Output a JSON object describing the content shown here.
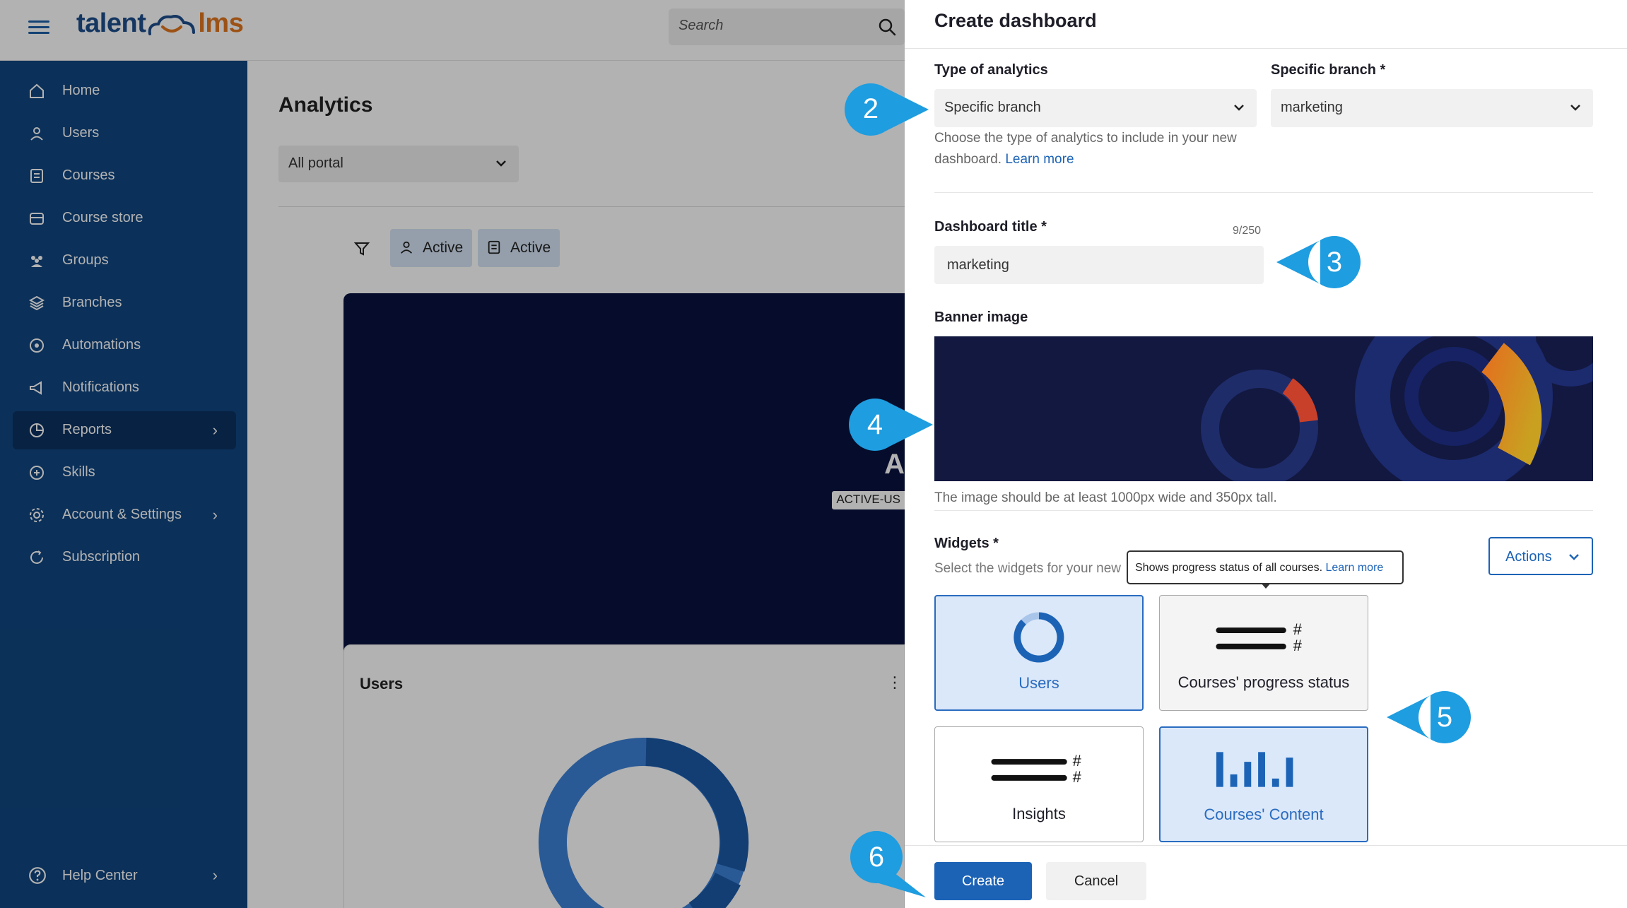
{
  "app": {
    "logo": {
      "part1": "talent",
      "part2": "lms"
    },
    "search": {
      "placeholder": "Search"
    },
    "sidebar": {
      "items": [
        {
          "label": "Home",
          "icon": "home-icon"
        },
        {
          "label": "Users",
          "icon": "user-icon"
        },
        {
          "label": "Courses",
          "icon": "book-icon"
        },
        {
          "label": "Course store",
          "icon": "store-icon"
        },
        {
          "label": "Groups",
          "icon": "group-icon"
        },
        {
          "label": "Branches",
          "icon": "layers-icon"
        },
        {
          "label": "Automations",
          "icon": "automation-icon"
        },
        {
          "label": "Notifications",
          "icon": "megaphone-icon"
        },
        {
          "label": "Reports",
          "icon": "pie-chart-icon",
          "active": true
        },
        {
          "label": "Skills",
          "icon": "skills-icon"
        },
        {
          "label": "Account & Settings",
          "icon": "gear-icon"
        },
        {
          "label": "Subscription",
          "icon": "subscription-icon"
        }
      ],
      "help": {
        "label": "Help Center",
        "icon": "help-circle-icon"
      }
    },
    "main": {
      "title": "Analytics",
      "portal_select": "All portal",
      "chips": [
        {
          "label": "Active",
          "icon": "user-icon"
        },
        {
          "label": "Active",
          "icon": "book-icon"
        }
      ],
      "banner_letter": "A",
      "banner_badge": "ACTIVE-US",
      "users_card_title": "Users",
      "users_card_menu": "⋮"
    }
  },
  "drawer": {
    "title": "Create dashboard",
    "type_of_analytics": {
      "label": "Type of analytics",
      "value": "Specific branch",
      "help": "Choose the type of analytics to include in your new dashboard.",
      "help_link": "Learn more"
    },
    "specific_branch": {
      "label": "Specific branch *",
      "value": "marketing"
    },
    "dashboard_title": {
      "label": "Dashboard title *",
      "value": "marketing",
      "counter": "9/250"
    },
    "banner": {
      "label": "Banner image",
      "note": "The image should be at least 1000px wide and 350px tall."
    },
    "widgets": {
      "label": "Widgets *",
      "subtitle": "Select the widgets for your new",
      "actions_label": "Actions",
      "tooltip": {
        "text": "Shows progress status of all courses.",
        "link": "Learn more"
      },
      "cards": [
        {
          "label": "Users",
          "selected": true,
          "icon": "donut-icon"
        },
        {
          "label": "Courses' progress status",
          "selected": false,
          "icon": "progress-lines-icon"
        },
        {
          "label": "Insights",
          "selected": false,
          "icon": "insights-lines-icon"
        },
        {
          "label": "Courses' Content",
          "selected": true,
          "icon": "bar-chart-icon"
        }
      ]
    },
    "buttons": {
      "create": "Create",
      "cancel": "Cancel"
    }
  },
  "callouts": [
    "2",
    "3",
    "4",
    "5",
    "6"
  ],
  "colors": {
    "sidebar": "#114680",
    "primary": "#1c63b6",
    "callout": "#1e9de0",
    "selected_card_bg": "#dbe8f9",
    "brand_orange": "#e0761f"
  }
}
